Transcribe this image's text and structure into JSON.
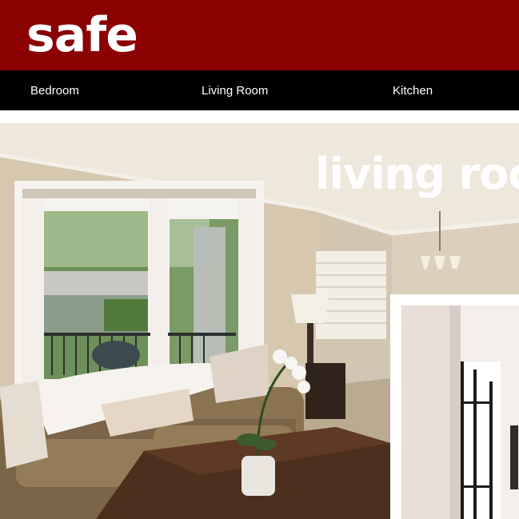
{
  "brand": {
    "logo_text": "safe"
  },
  "nav": {
    "items": [
      {
        "label": "Bedroom"
      },
      {
        "label": "Living Room"
      },
      {
        "label": "Kitchen"
      }
    ]
  },
  "hero": {
    "title": "living roo"
  },
  "colors": {
    "header_bg": "#8b0000",
    "nav_bg": "#000000",
    "text_light": "#ffffff"
  }
}
